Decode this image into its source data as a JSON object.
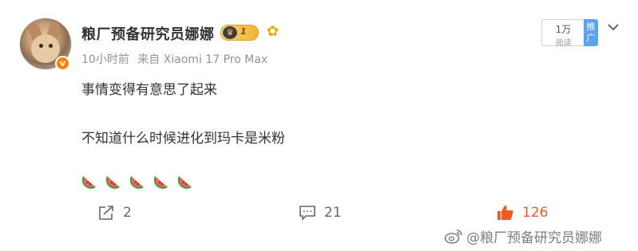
{
  "post": {
    "username": "粮厂预备研究员娜娜",
    "vip_level": "1",
    "time": "10小时前",
    "source": "来自 Xiaomi 17 Pro Max",
    "content_line1": "事情变得有意思了起来",
    "content_line2": "不知道什么时候进化到玛卡是米粉",
    "emoji_count": 5,
    "reads": "1万",
    "reads_label": "阅读",
    "promote_label": "推广"
  },
  "actions": {
    "share_count": "2",
    "comment_count": "21",
    "like_count": "126"
  },
  "watermark": "@粮厂预备研究员娜娜",
  "colors": {
    "like": "#f15a22",
    "verified": "#ff8200",
    "promote": "#5aa4f0",
    "meta": "#939393"
  },
  "icons": [
    "chevron-down-icon",
    "share-icon",
    "comment-icon",
    "like-icon",
    "watermelon-icon",
    "crown-icon",
    "sunflower-icon",
    "weibo-logo-icon"
  ]
}
